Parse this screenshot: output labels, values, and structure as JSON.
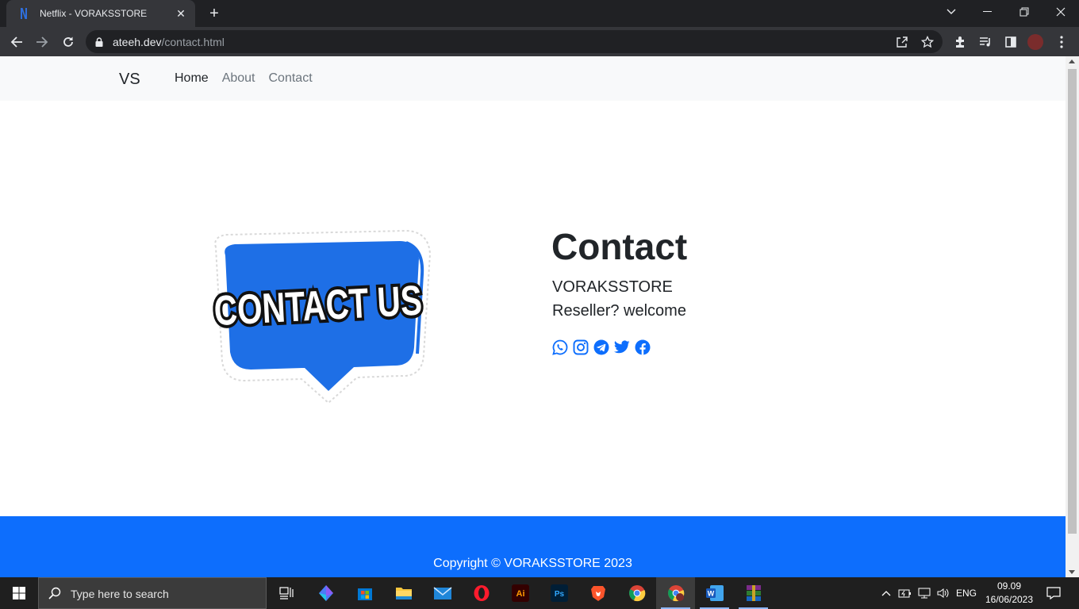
{
  "browser": {
    "tab_title": "Netflix - VORAKSSTORE",
    "url_host": "ateeh.dev",
    "url_path": "/contact.html"
  },
  "site": {
    "brand": "VS",
    "nav": [
      {
        "label": "Home"
      },
      {
        "label": "About"
      },
      {
        "label": "Contact"
      }
    ],
    "heading": "Contact",
    "line1": "VORAKSSTORE",
    "line2": "Reseller? welcome",
    "image_text": "CONTACT US",
    "socials": [
      "whatsapp-icon",
      "instagram-icon",
      "telegram-icon",
      "twitter-icon",
      "facebook-icon"
    ],
    "footer": "Copyright © VORAKSSTORE 2023",
    "colors": {
      "accent": "#0d6efd",
      "navbar": "#f8f9fa",
      "text": "#212529"
    }
  },
  "taskbar": {
    "search_placeholder": "Type here to search",
    "language": "ENG",
    "time": "09.09",
    "date": "16/06/2023"
  }
}
